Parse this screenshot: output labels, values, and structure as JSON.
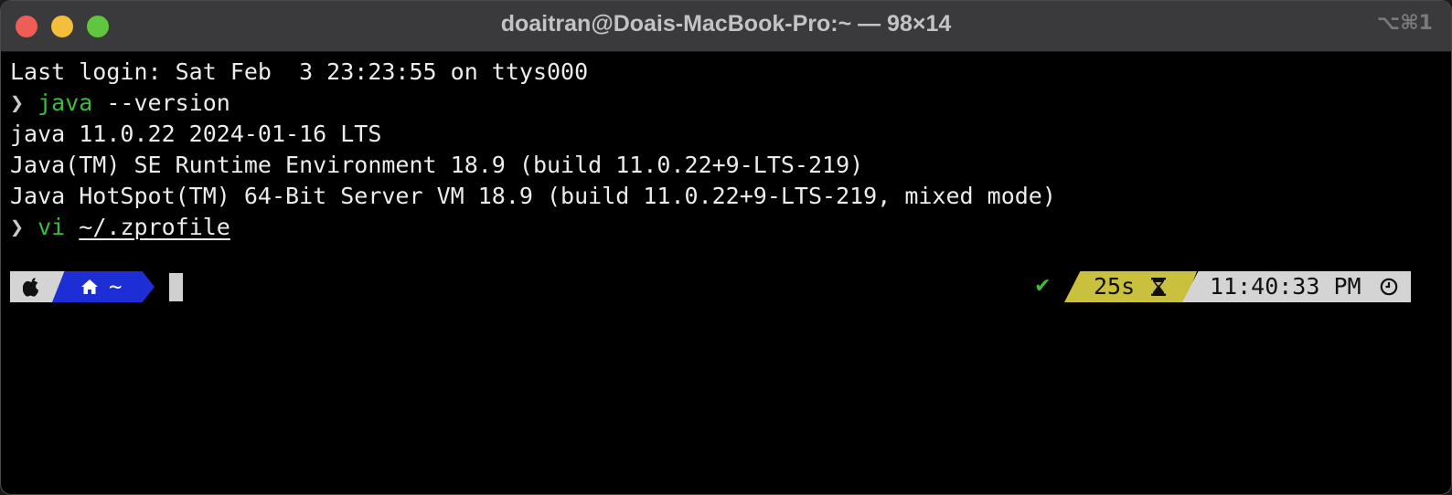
{
  "window": {
    "title": "doaitran@Doais-MacBook-Pro:~ — 98×14",
    "shortcut": "⌥⌘1"
  },
  "terminal": {
    "lines": [
      {
        "text": "Last login: Sat Feb  3 23:23:55 on ttys000"
      },
      {
        "prompt": "❯",
        "command": "java",
        "args": " --version"
      },
      {
        "text": "java 11.0.22 2024-01-16 LTS"
      },
      {
        "text": "Java(TM) SE Runtime Environment 18.9 (build 11.0.22+9-LTS-219)"
      },
      {
        "text": "Java HotSpot(TM) 64-Bit Server VM 18.9 (build 11.0.22+9-LTS-219, mixed mode)"
      },
      {
        "prompt": "❯",
        "command": "vi",
        "args": "~/.zprofile"
      }
    ]
  },
  "prompt": {
    "os_icon": "apple-icon",
    "home_icon": "home-icon",
    "path": "~",
    "status_icon": "✔",
    "duration": "25s",
    "duration_icon": "hourglass-icon",
    "time": "11:40:33 PM",
    "time_icon": "clock-icon"
  },
  "colors": {
    "close": "#ee5e57",
    "minimize": "#f4bd3a",
    "zoom": "#5fc63d",
    "command": "#3fbb3f",
    "path_segment": "#1d2ed4",
    "duration_segment": "#c9c13e"
  }
}
